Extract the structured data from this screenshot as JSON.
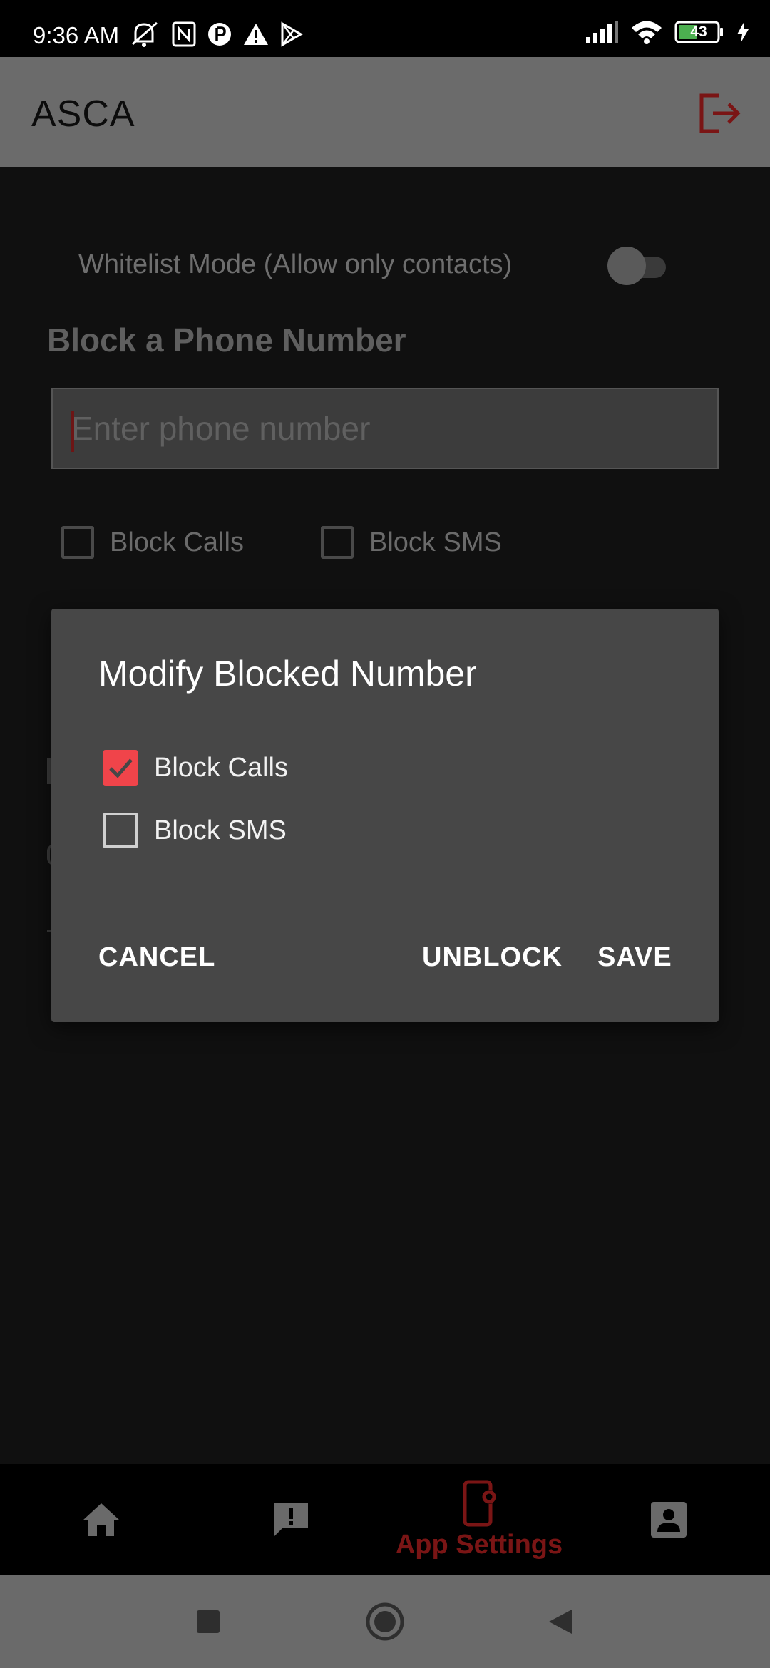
{
  "status_bar": {
    "time": "9:36 AM",
    "battery": "43",
    "left_icons": [
      "mute-icon",
      "nfc-icon",
      "app-notification-icon",
      "warning-icon",
      "play-store-icon"
    ],
    "right_icons": [
      "signal-icon",
      "wifi-icon",
      "battery-icon",
      "charging-icon"
    ]
  },
  "app_bar": {
    "title": "ASCA",
    "action_icon": "logout-icon",
    "action_color": "#7a1515"
  },
  "settings": {
    "whitelist_label": "Whitelist Mode (Allow only contacts)",
    "whitelist_on": false,
    "section_title": "Block a Phone Number",
    "phone_placeholder": "Enter phone number",
    "phone_value": "",
    "block_calls_label": "Block Calls",
    "block_sms_label": "Block SMS"
  },
  "dialog": {
    "title": "Modify Blocked Number",
    "options": [
      {
        "label": "Block Calls",
        "checked": true
      },
      {
        "label": "Block SMS",
        "checked": false
      }
    ],
    "cancel": "CANCEL",
    "unblock": "UNBLOCK",
    "save": "SAVE",
    "accent": "#f0444a"
  },
  "bottom_nav": {
    "items": [
      {
        "icon": "home-icon",
        "label": ""
      },
      {
        "icon": "report-icon",
        "label": ""
      },
      {
        "icon": "app-settings-icon",
        "label": "App Settings",
        "active": true
      },
      {
        "icon": "profile-icon",
        "label": ""
      }
    ],
    "active_color": "#7a1515"
  },
  "system_nav": {
    "icons": [
      "recents-icon",
      "home-circle-icon",
      "back-icon"
    ]
  }
}
